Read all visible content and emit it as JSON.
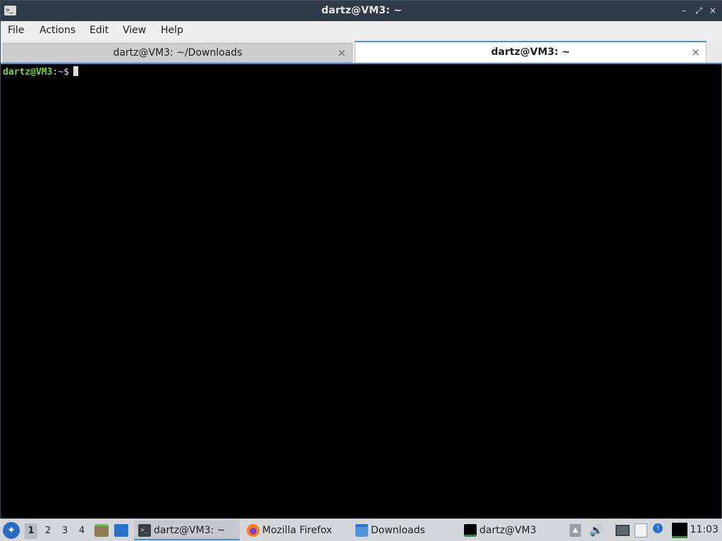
{
  "window": {
    "title": "dartz@VM3: ~",
    "app_icon": "terminal-icon",
    "controls": {
      "minimize": "–",
      "maximize": "⤢",
      "close": "×"
    }
  },
  "menubar": {
    "items": [
      "File",
      "Actions",
      "Edit",
      "View",
      "Help"
    ]
  },
  "tabs": [
    {
      "label": "dartz@VM3: ~/Downloads",
      "active": false,
      "close": "×"
    },
    {
      "label": "dartz@VM3: ~",
      "active": true,
      "close": "×"
    }
  ],
  "terminal": {
    "prompt_user": "dartz@VM3",
    "prompt_sep": ":",
    "prompt_path": "~",
    "prompt_symbol": "$"
  },
  "taskbar": {
    "start_icon": "start-menu-icon",
    "workspaces": [
      "1",
      "2",
      "3",
      "4"
    ],
    "active_workspace": "1",
    "quick_launch": [
      "file-manager-icon",
      "show-desktop-icon"
    ],
    "tasks": [
      {
        "label": "dartz@VM3: ~",
        "icon": "terminal-icon",
        "active": true
      },
      {
        "label": "Mozilla Firefox",
        "icon": "firefox-icon",
        "active": false
      },
      {
        "label": "Downloads",
        "icon": "folder-icon",
        "active": false
      },
      {
        "label": "dartz@VM3",
        "icon": "terminal-monitor-icon",
        "active": false
      }
    ],
    "tray": [
      "up-arrow-icon",
      "volume-icon",
      "network-icon",
      "clipboard-icon",
      "notification-icon",
      "cpu-monitor-icon"
    ],
    "clock": "11:03"
  },
  "colors": {
    "prompt_user": "#76d639",
    "prompt_path": "#6aa6ff",
    "accent": "#4a90d9",
    "titlebar": "#2f3b48"
  }
}
